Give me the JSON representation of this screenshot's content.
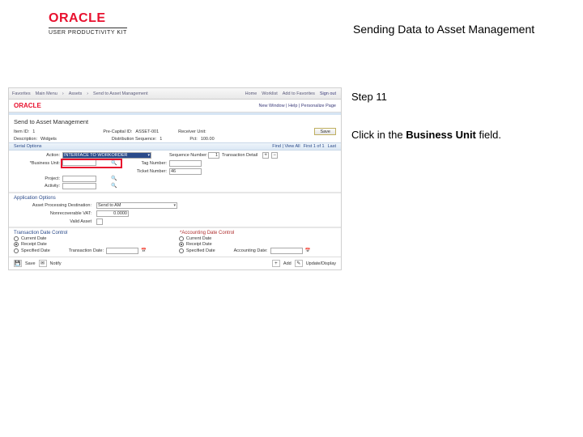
{
  "brand": {
    "oracle": "ORACLE",
    "upk": "USER PRODUCTIVITY KIT"
  },
  "doc_title": "Sending Data to Asset Management",
  "instruction": {
    "step": "Step 11",
    "text_prefix": "Click in the ",
    "field_name": "Business Unit",
    "text_suffix": " field."
  },
  "app": {
    "tabs": {
      "favorites": "Favorites",
      "main_menu": "Main Menu",
      "crumb1": "Assets",
      "crumb2": "Send to Asset Management",
      "home": "Home",
      "worklist": "Worklist",
      "add_fav": "Add to Favorites",
      "signout": "Sign out"
    },
    "brandbar": {
      "oracle": "ORACLE",
      "personalize": "New Window | Help | Personalize Page"
    },
    "page_title": "Send to Asset Management",
    "info_row": {
      "item_id_lbl": "Item ID:",
      "item_id_val": "1",
      "pre_lbl": "Pre-Capital ID:",
      "pre_val": "ASSET-001",
      "recv_lbl": "Receiver Unit:",
      "recv_val": "",
      "save_btn": "Save"
    },
    "info_row2": {
      "desc_lbl": "Description:",
      "desc_val": "Widgets",
      "seq_lbl": "Distribution Sequence:",
      "seq_val": "1",
      "pct_lbl": "Pct:",
      "pct_val": "100.00"
    },
    "serial_section": {
      "title": "Serial Options",
      "find": "Find | View All",
      "range": "First 1 of 1",
      "last": "Last"
    },
    "serial_grid": {
      "action_lbl": "Action:",
      "action_val": "INTERFACE TO WORKORDER",
      "seq_lbl": "Sequence Number:",
      "seq_val": "1",
      "trans_lbl": "Transaction Detail",
      "bu_lbl": "*Business Unit:",
      "bu_val": "",
      "tag_lbl": "Tag Number:",
      "tag_val": "",
      "ticket_lbl": "Ticket Number:",
      "ticket_val": "46",
      "project_lbl": "Project:",
      "project_val": "",
      "activity_lbl": "Activity:",
      "activity_val": ""
    },
    "apo": {
      "title": "Application Options",
      "dest_lbl": "Asset Processing Destination:",
      "dest_val": "Send to AM",
      "vat_lbl": "Nonrecoverable VAT:",
      "vat_val": "0.0000",
      "valid_lbl": "Valid Asset"
    },
    "tdc": {
      "title": "Transaction Date Control",
      "left": {
        "o1": "Current Date",
        "o2": "Receipt Date",
        "o3": "Specified Date"
      },
      "mid_lbl": "Transaction Date:",
      "adc_title": "*Accounting Date Control",
      "right": {
        "o1": "Current Date",
        "o2": "Receipt Date",
        "o3": "Specified Date"
      },
      "acct_lbl": "Accounting Date:"
    },
    "toolbar": {
      "save": "Save",
      "notify": "Notify",
      "add": "Add",
      "update": "Update/Display"
    }
  }
}
